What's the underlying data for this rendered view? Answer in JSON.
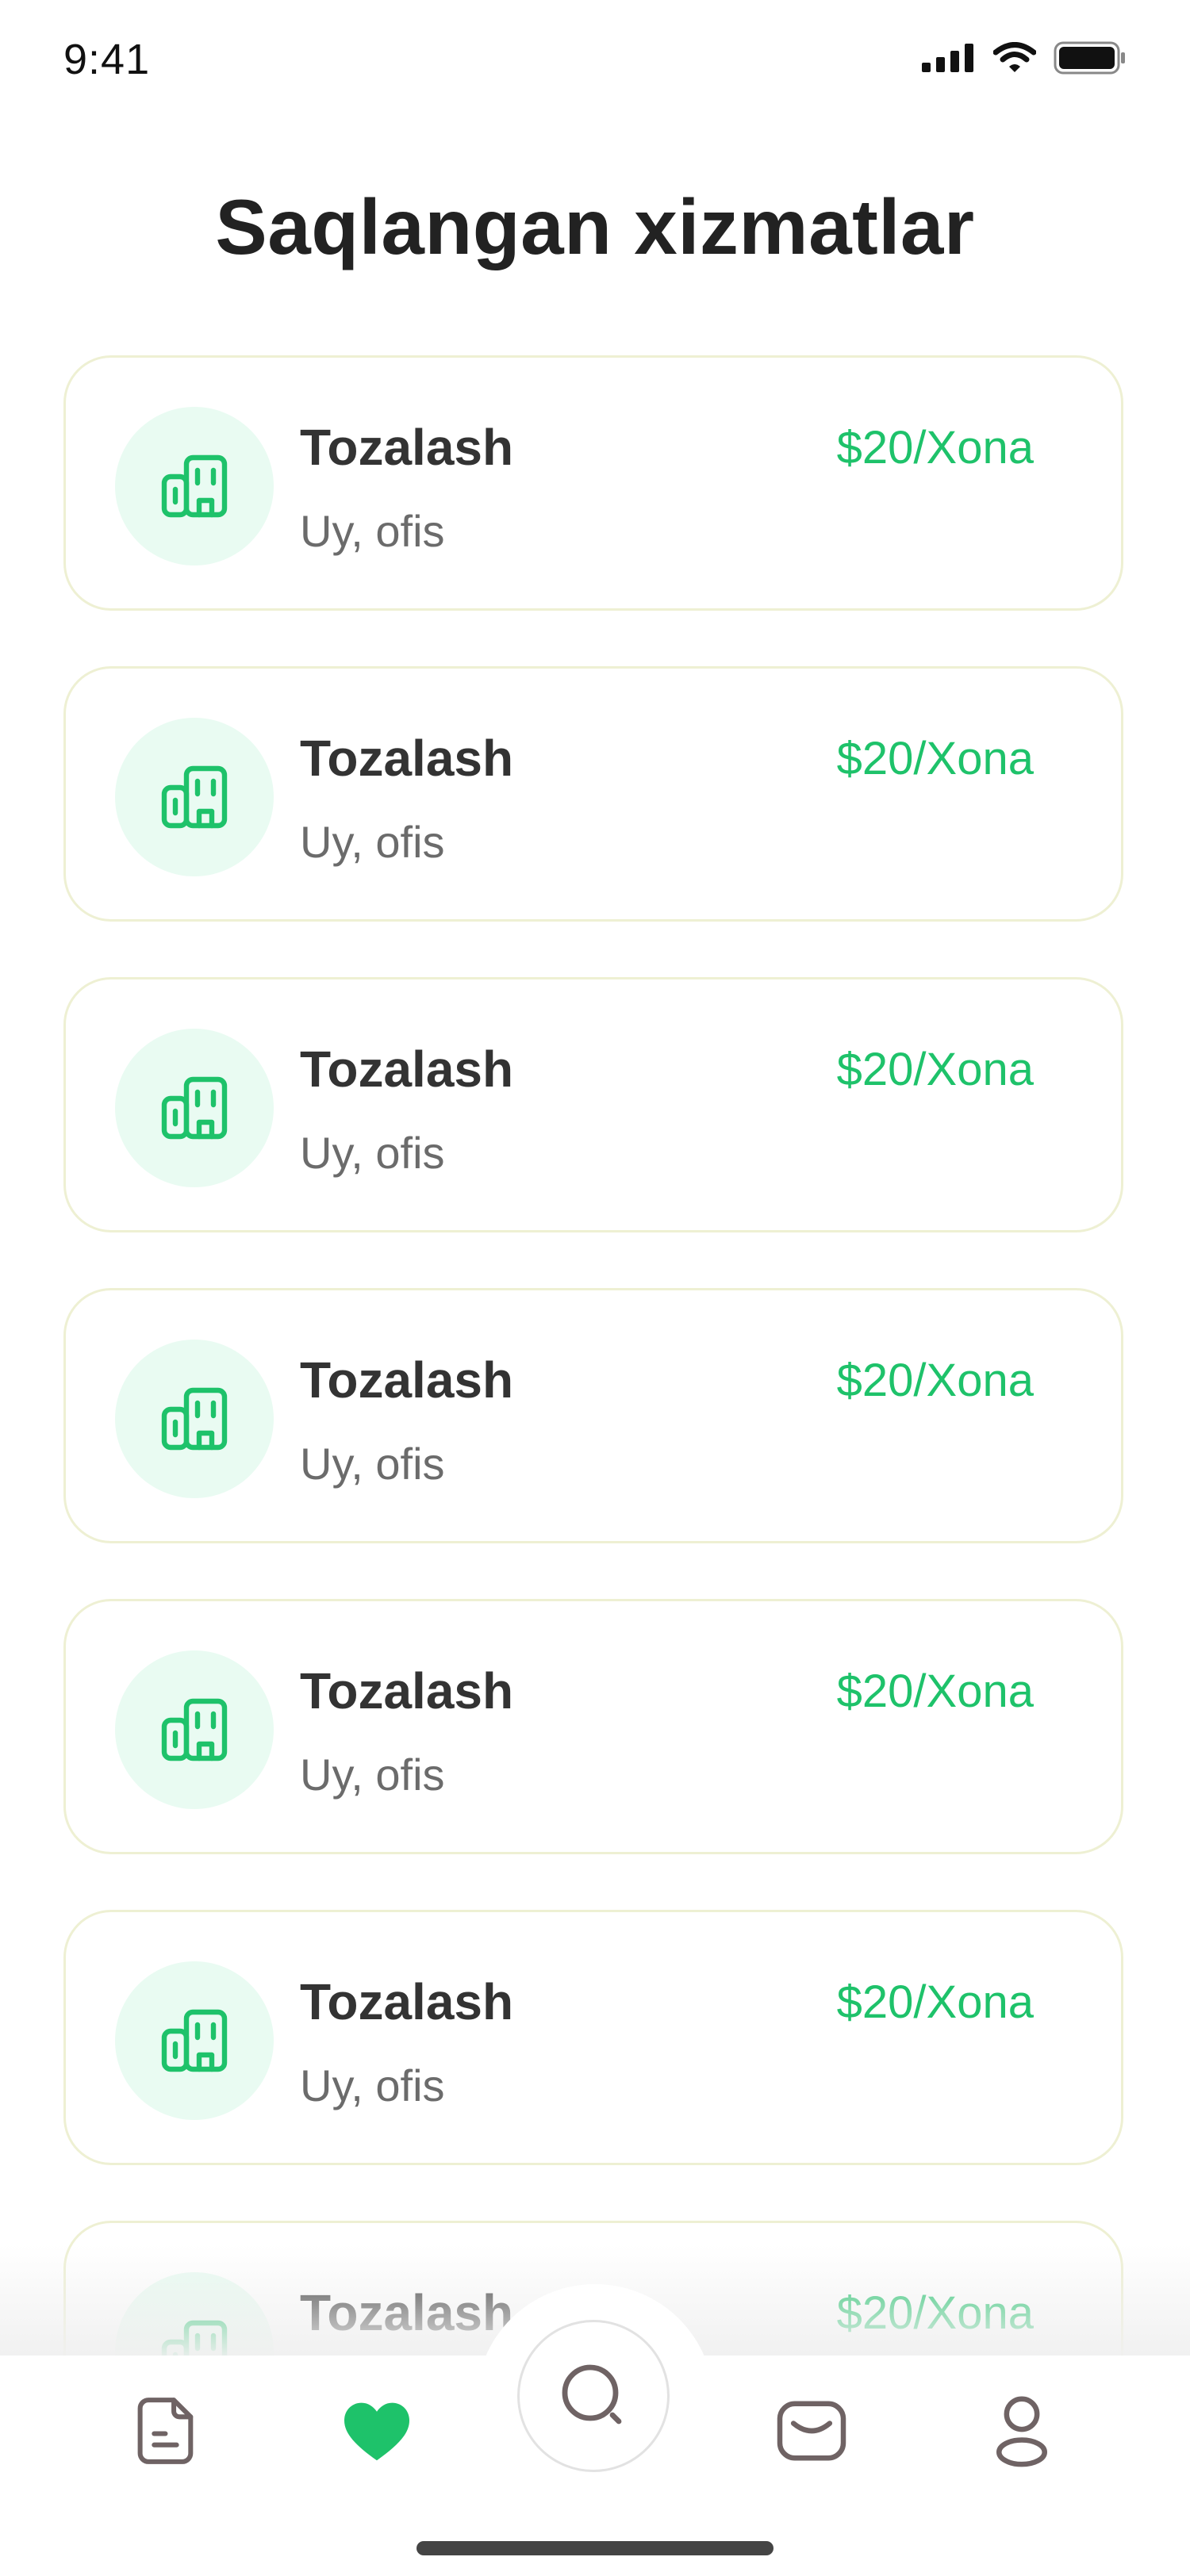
{
  "status_bar": {
    "time": "9:41"
  },
  "page": {
    "title": "Saqlangan xizmatlar"
  },
  "services": [
    {
      "title": "Tozalash",
      "subtitle": "Uy, ofis",
      "price": "$20/Xona"
    },
    {
      "title": "Tozalash",
      "subtitle": "Uy, ofis",
      "price": "$20/Xona"
    },
    {
      "title": "Tozalash",
      "subtitle": "Uy, ofis",
      "price": "$20/Xona"
    },
    {
      "title": "Tozalash",
      "subtitle": "Uy, ofis",
      "price": "$20/Xona"
    },
    {
      "title": "Tozalash",
      "subtitle": "Uy, ofis",
      "price": "$20/Xona"
    },
    {
      "title": "Tozalash",
      "subtitle": "Uy, ofis",
      "price": "$20/Xona"
    },
    {
      "title": "Tozalash",
      "subtitle": "Uy, ofis",
      "price": "$20/Xona"
    }
  ],
  "tab_bar": {
    "items": [
      {
        "icon": "document-icon",
        "active": false
      },
      {
        "icon": "heart-icon",
        "active": true
      },
      {
        "icon": "search-icon",
        "active": false
      },
      {
        "icon": "inbox-icon",
        "active": false
      },
      {
        "icon": "profile-icon",
        "active": false
      }
    ]
  },
  "colors": {
    "accent": "#1ec26a",
    "icon_bg": "#e9fbf2",
    "card_border": "#eef0d3",
    "inactive_icon": "#6f6364"
  }
}
